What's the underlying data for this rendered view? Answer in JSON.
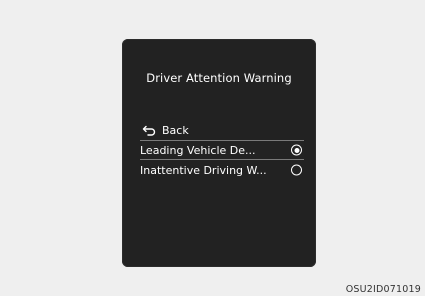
{
  "screen": {
    "title": "Driver Attention Warning",
    "back_label": "Back",
    "options": [
      {
        "label": "Leading Vehicle De...",
        "selected": true
      },
      {
        "label": "Inattentive Driving W...",
        "selected": false
      }
    ]
  },
  "caption": "OSU2ID071019"
}
